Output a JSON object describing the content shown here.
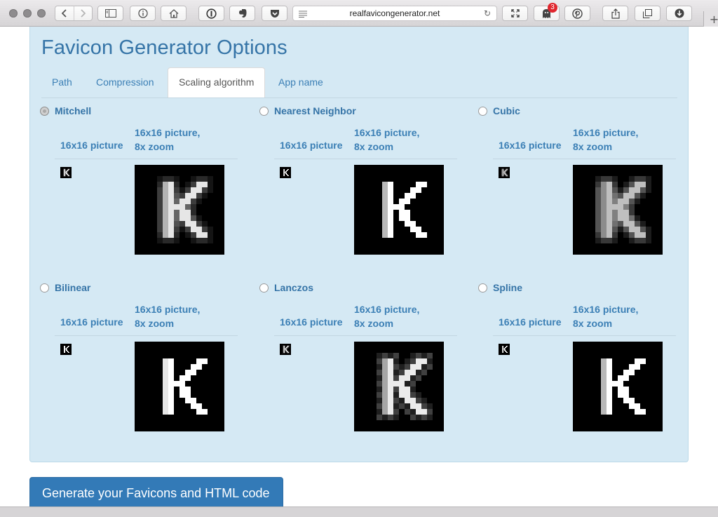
{
  "browser": {
    "url": "realfavicongenerator.net",
    "extension_badge": "3"
  },
  "page": {
    "title": "Favicon Generator Options",
    "tabs": [
      {
        "label": "Path",
        "active": false
      },
      {
        "label": "Compression",
        "active": false
      },
      {
        "label": "Scaling algorithm",
        "active": true
      },
      {
        "label": "App name",
        "active": false
      }
    ],
    "column_headers": {
      "small": "16x16 picture",
      "zoom_line1": "16x16 picture,",
      "zoom_line2": "8x zoom"
    },
    "options": [
      {
        "name": "Mitchell",
        "selected": true,
        "style": "soft"
      },
      {
        "name": "Nearest Neighbor",
        "selected": false,
        "style": "sharp"
      },
      {
        "name": "Cubic",
        "selected": false,
        "style": "blur"
      },
      {
        "name": "Bilinear",
        "selected": false,
        "style": "bright"
      },
      {
        "name": "Lanczos",
        "selected": false,
        "style": "ring"
      },
      {
        "name": "Spline",
        "selected": false,
        "style": "sharp"
      }
    ],
    "submit_label": "Generate your Favicons and HTML code"
  },
  "colors": {
    "panel": "#d5e9f4",
    "title": "#3574a7",
    "link": "#3b7fb5",
    "primary_button": "#337ab7"
  }
}
